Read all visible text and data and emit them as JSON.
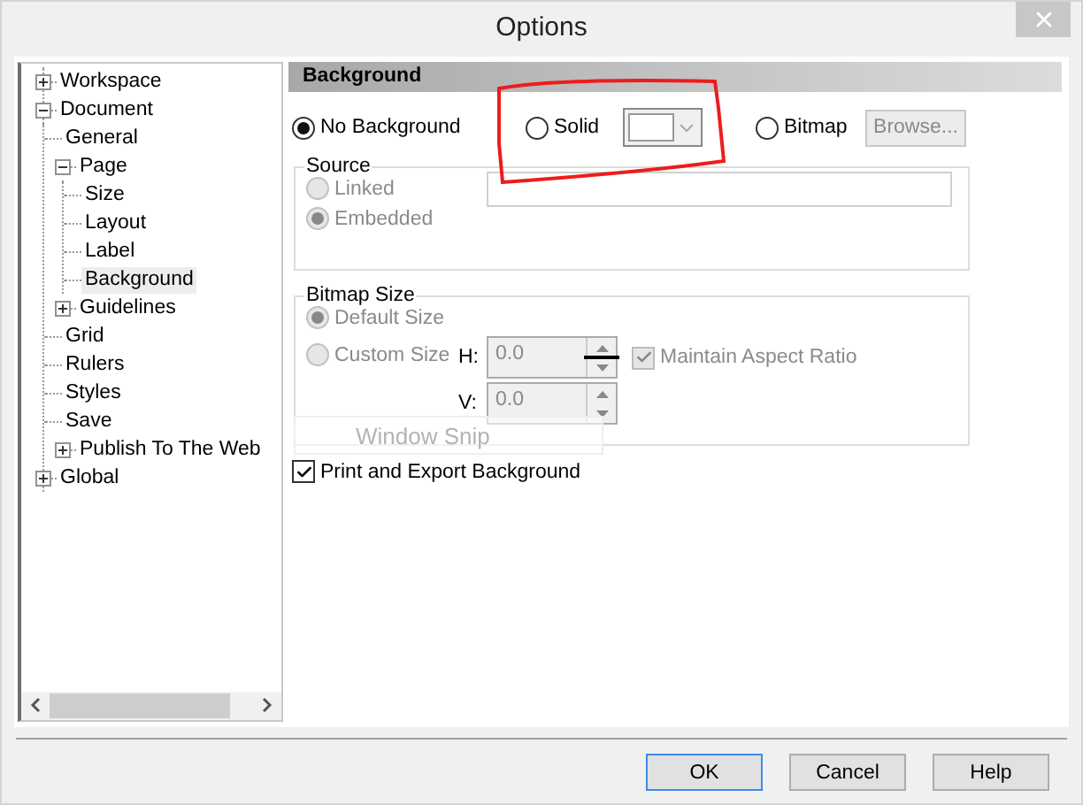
{
  "window": {
    "title": "Options"
  },
  "tree": [
    {
      "label": "Workspace",
      "expanded": false,
      "selected": false
    },
    {
      "label": "Document",
      "expanded": true,
      "selected": false,
      "children": [
        {
          "label": "General",
          "selected": false
        },
        {
          "label": "Page",
          "expanded": true,
          "selected": false,
          "children": [
            {
              "label": "Size",
              "selected": false
            },
            {
              "label": "Layout",
              "selected": false
            },
            {
              "label": "Label",
              "selected": false
            },
            {
              "label": "Background",
              "selected": true
            }
          ]
        },
        {
          "label": "Guidelines",
          "expanded": false,
          "selected": false
        },
        {
          "label": "Grid",
          "selected": false
        },
        {
          "label": "Rulers",
          "selected": false
        },
        {
          "label": "Styles",
          "selected": false
        },
        {
          "label": "Save",
          "selected": false
        },
        {
          "label": "Publish To The Web",
          "expanded": false,
          "selected": false
        }
      ]
    },
    {
      "label": "Global",
      "expanded": false,
      "selected": false
    }
  ],
  "panel": {
    "title": "Background",
    "background_options": [
      {
        "label": "No Background",
        "selected": true
      },
      {
        "label": "Solid",
        "selected": false
      },
      {
        "label": "Bitmap",
        "selected": false
      }
    ],
    "browse_button": {
      "label": "Browse...",
      "disabled": true
    },
    "source": {
      "title": "Source",
      "disabled": true,
      "options": [
        {
          "label": "Linked",
          "selected": false
        },
        {
          "label": "Embedded",
          "selected": true
        }
      ]
    },
    "bitmap_size": {
      "title": "Bitmap Size",
      "disabled": true,
      "options": [
        {
          "label": "Default Size",
          "selected": true
        },
        {
          "label": "Custom Size",
          "selected": false
        }
      ],
      "fields": [
        {
          "label": "H:",
          "value": "0.0"
        },
        {
          "label": "V:",
          "value": "0.0"
        }
      ],
      "maintain_aspect": {
        "label": "Maintain Aspect Ratio",
        "checked": true
      }
    },
    "print_export": {
      "label": "Print and Export Background",
      "checked": true
    },
    "snip_ghost": {
      "label": "Window Snip"
    }
  },
  "buttons": [
    {
      "label": "OK",
      "default": true
    },
    {
      "label": "Cancel",
      "default": false
    },
    {
      "label": "Help",
      "default": false
    }
  ]
}
